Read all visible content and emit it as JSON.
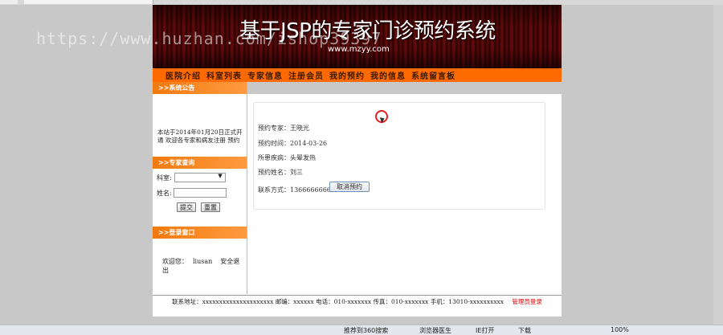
{
  "banner": {
    "title": "基于JSP的专家门诊预约系统",
    "url": "www.mzyy.com"
  },
  "watermark": "https://www.huzhan.com/ishop39397",
  "nav": [
    "医院介绍",
    "科室列表",
    "专家信息",
    "注册会员",
    "我的预约",
    "我的信息",
    "系统留言板"
  ],
  "sidebar": {
    "notice_title": ">>系统公告",
    "notice_text": "本站于2014年01月20日正式开通 欢迎各专家和病友注册 预约",
    "search_title": ">>专家查询",
    "dept_label": "科室:",
    "name_label": "姓名:",
    "submit_label": "提交",
    "reset_label": "重置",
    "login_title": ">>登录窗口",
    "welcome": "欢迎您：",
    "username": "liusan",
    "logout": "安全退出"
  },
  "appointment": {
    "expert": "预约专家：王晓光",
    "time": "预约时间：2014-03-26",
    "illness": "所患疾病：头晕发热",
    "patient": "预约姓名：刘三",
    "contact": "联系方式：13666666666",
    "cancel_label": "取消预约"
  },
  "footer": {
    "address": "联系地址：xxxxxxxxxxxxxxxxxxxxx",
    "postcode": "邮编：xxxxxx",
    "phone": "电话：010-xxxxxxx",
    "fax": "传真：010-xxxxxxx",
    "mobile": "手机：13010-xxxxxxxxxx",
    "admin_login": "管理员登录"
  },
  "statusbar": {
    "item1": "推荐到360搜索",
    "item2": "浏览器医生",
    "item3": "IE打开",
    "item4": "下载",
    "zoom": "100%"
  }
}
